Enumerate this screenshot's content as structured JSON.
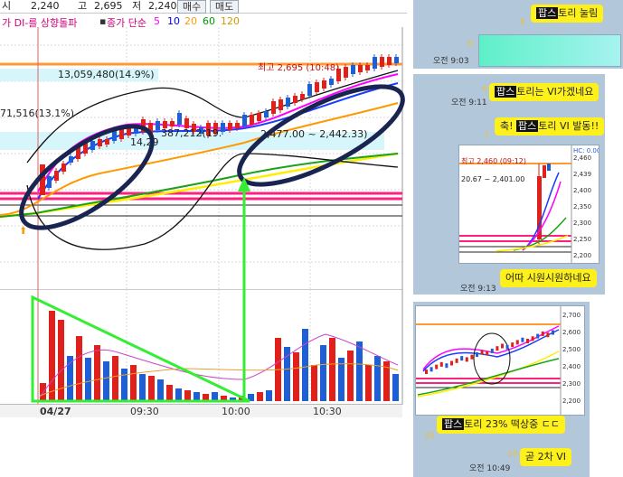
{
  "chart": {
    "topbar": {
      "label_si": "시",
      "open": "2,240",
      "label_go": "고",
      "high": "2,695",
      "label_jeo": "저",
      "low": "2,240",
      "buy_button": "매수",
      "sell_button": "매도"
    },
    "legend": {
      "prefix": "가 DI-를 상향돌파",
      "ma_label": "종가 단순",
      "ma_periods": [
        "5",
        "10",
        "20",
        "60",
        "120"
      ],
      "ma_colors": [
        "#ff00ff",
        "#0000ff",
        "#ff9900",
        "#009900",
        "#cc9900"
      ]
    },
    "annotations": {
      "retrace_pct": "13,059,480(14.9%)",
      "left_pct": "71,516(13.1%)",
      "mid_values": "387,212(19.",
      "mid_values_2": "14,29",
      "range_text": "2,477.00 ~ 2,442.33)",
      "high_marker": "최고 2,695 (10:48)"
    },
    "time_axis": {
      "labels": [
        "04/27",
        "09:30",
        "10:00",
        "10:30"
      ]
    },
    "colors": {
      "up_candle": "#e0201a",
      "down_candle": "#1f5fd6",
      "highlight_green": "#33ee33",
      "circle_navy": "#1a2450"
    }
  },
  "chart_data": {
    "type": "candlestick",
    "title": "",
    "x_labels": [
      "04/27",
      "09:30",
      "10:00",
      "10:30"
    ],
    "y_range": [
      2200,
      2700
    ],
    "open": 2240,
    "high": 2695,
    "low": 2240,
    "high_time": "10:48"
  },
  "chat": {
    "pane1": {
      "bubble_tag": "팝스",
      "bubble_text": "토리 눌림",
      "read_count": "6",
      "image_read_count": "6",
      "time": "오전 9:03"
    },
    "pane2": {
      "msg1_read": "6",
      "msg1_tag": "팝스",
      "msg1_text": "토리는 VI가겠네요",
      "msg1_time": "오전 9:11",
      "msg2_read": "7",
      "msg2_tag": "팝스",
      "msg2_text_before": "축! ",
      "msg2_text_after": "토리 VI 발동!!",
      "thumb_high": "최고 2,460 (09:12)",
      "thumb_range": "20.67 ~ 2,401.00",
      "thumb_top_right": "HC: 0.00",
      "thumb_prices": [
        "2,460",
        "2,439",
        "2,400",
        "2,350",
        "2,300",
        "2,250",
        "2,200"
      ],
      "msg3_read": "7",
      "msg3_text": "어따 시원시원하네요",
      "msg3_time": "오전 9:13"
    },
    "pane3": {
      "thumb_prices": [
        "2,700",
        "2,600",
        "2,500",
        "2,400",
        "2,300",
        "2,200"
      ],
      "msg1_read": "10",
      "msg1_tag": "팝스",
      "msg1_text": "토리 23% 떡상중 ㄷㄷ",
      "msg2_read": "10",
      "msg2_text": "곧 2차 VI",
      "msg2_time": "오전 10:49"
    }
  }
}
